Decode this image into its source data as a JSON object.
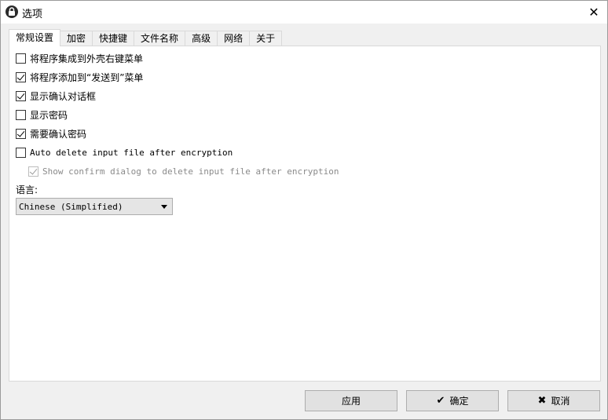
{
  "window": {
    "title": "选项",
    "close_glyph": "✕",
    "icon": "lock-icon"
  },
  "tabs": [
    {
      "label": "常规设置",
      "active": true
    },
    {
      "label": "加密",
      "active": false
    },
    {
      "label": "快捷键",
      "active": false
    },
    {
      "label": "文件名称",
      "active": false
    },
    {
      "label": "高级",
      "active": false
    },
    {
      "label": "网络",
      "active": false
    },
    {
      "label": "关于",
      "active": false
    }
  ],
  "options": [
    {
      "label": "将程序集成到外壳右键菜单",
      "checked": false,
      "enabled": true
    },
    {
      "label": "将程序添加到“发送到”菜单",
      "checked": true,
      "enabled": true
    },
    {
      "label": "显示确认对话框",
      "checked": true,
      "enabled": true
    },
    {
      "label": "显示密码",
      "checked": false,
      "enabled": true
    },
    {
      "label": "需要确认密码",
      "checked": true,
      "enabled": true
    },
    {
      "label": "Auto delete input file after encryption",
      "checked": false,
      "enabled": true
    },
    {
      "label": "Show confirm dialog to delete input file after encryption",
      "checked": true,
      "enabled": false
    }
  ],
  "language": {
    "label": "语言:",
    "selected": "Chinese (Simplified)"
  },
  "buttons": {
    "apply": "应用",
    "ok": "确定",
    "ok_icon": "✔",
    "cancel": "取消",
    "cancel_icon": "✖"
  }
}
